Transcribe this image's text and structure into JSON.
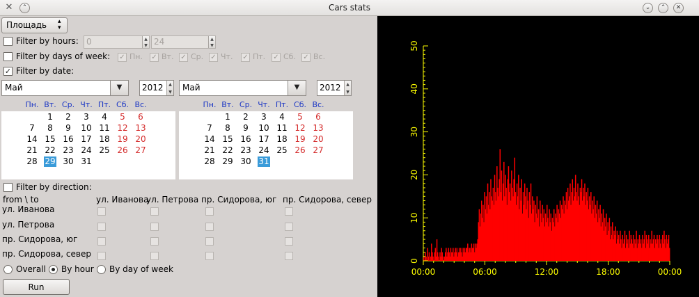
{
  "window": {
    "title": "Cars stats"
  },
  "metric": {
    "selected": "Площадь"
  },
  "hours": {
    "label": "Filter by hours:",
    "from": "0",
    "to": "24",
    "checked": false
  },
  "days_of_week": {
    "label": "Filter by days of week:",
    "checked": false,
    "days": [
      "Пн.",
      "Вт.",
      "Ср.",
      "Чт.",
      "Пт.",
      "Сб.",
      "Вс."
    ]
  },
  "date": {
    "label": "Filter by date:",
    "checked": true
  },
  "calendar_from": {
    "month": "Май",
    "year": "2012",
    "selected_day": 29
  },
  "calendar_to": {
    "month": "Май",
    "year": "2012",
    "selected_day": 31
  },
  "calendar_headers": [
    "Пн.",
    "Вт.",
    "Ср.",
    "Чт.",
    "Пт.",
    "Сб.",
    "Вс."
  ],
  "calendar_weeks": [
    [
      "",
      "1",
      "2",
      "3",
      "4",
      "5",
      "6"
    ],
    [
      "7",
      "8",
      "9",
      "10",
      "11",
      "12",
      "13"
    ],
    [
      "14",
      "15",
      "16",
      "17",
      "18",
      "19",
      "20"
    ],
    [
      "21",
      "22",
      "23",
      "24",
      "25",
      "26",
      "27"
    ],
    [
      "28",
      "29",
      "30",
      "31",
      "",
      "",
      ""
    ]
  ],
  "direction": {
    "label": "Filter by direction:",
    "checked": false,
    "corner": "from \\ to",
    "columns": [
      "ул. Иванова",
      "ул. Петрова",
      "пр. Сидорова, юг",
      "пр. Сидорова, север"
    ],
    "rows": [
      "ул. Иванова",
      "ул. Петрова",
      "пр. Сидорова, юг",
      "пр. Сидорова, север"
    ]
  },
  "mode": {
    "options": [
      "Overall",
      "By hour",
      "By day of week"
    ],
    "selected": "By hour"
  },
  "run_label": "Run",
  "colors": {
    "bars": "#ff0000",
    "axis": "#ffff00",
    "background": "#000000",
    "weekend": "#d42a2a",
    "weekday_header": "#1c37c4",
    "selection": "#3a9bd9"
  },
  "chart_data": {
    "type": "bar",
    "title": "",
    "xlabel": "",
    "ylabel": "",
    "ylim": [
      0,
      50
    ],
    "yticks": [
      "0",
      "10",
      "20",
      "30",
      "40",
      "50"
    ],
    "xlim": [
      "00:00",
      "24:00"
    ],
    "xticks": [
      "00:00",
      "06:00",
      "12:00",
      "18:00",
      "00:00"
    ],
    "bin_minutes": 3,
    "values": [
      1,
      0,
      2,
      1,
      0,
      3,
      1,
      2,
      0,
      1,
      4,
      2,
      1,
      0,
      2,
      3,
      1,
      5,
      2,
      1,
      0,
      2,
      1,
      3,
      2,
      1,
      0,
      1,
      2,
      3,
      1,
      2,
      3,
      2,
      1,
      3,
      2,
      2,
      3,
      1,
      2,
      3,
      2,
      3,
      1,
      2,
      3,
      2,
      3,
      2,
      1,
      3,
      2,
      3,
      2,
      3,
      3,
      4,
      2,
      3,
      3,
      2,
      4,
      3,
      3,
      4,
      2,
      4,
      3,
      4,
      5,
      9,
      12,
      8,
      11,
      14,
      10,
      13,
      9,
      16,
      12,
      15,
      11,
      18,
      13,
      16,
      12,
      19,
      15,
      14,
      17,
      13,
      20,
      16,
      14,
      22,
      17,
      15,
      19,
      26,
      16,
      21,
      14,
      18,
      23,
      15,
      20,
      17,
      13,
      19,
      22,
      16,
      18,
      14,
      21,
      17,
      15,
      19,
      24,
      16,
      13,
      18,
      15,
      20,
      12,
      17,
      14,
      19,
      11,
      16,
      13,
      18,
      15,
      12,
      17,
      14,
      10,
      16,
      13,
      18,
      11,
      15,
      12,
      14,
      9,
      13,
      11,
      15,
      10,
      12,
      8,
      14,
      11,
      9,
      13,
      10,
      12,
      8,
      11,
      9,
      13,
      10,
      8,
      12,
      9,
      11,
      7,
      10,
      9,
      12,
      8,
      11,
      10,
      13,
      9,
      12,
      11,
      14,
      10,
      13,
      12,
      15,
      11,
      14,
      13,
      16,
      12,
      17,
      14,
      15,
      18,
      13,
      16,
      19,
      14,
      17,
      15,
      20,
      16,
      14,
      18,
      15,
      13,
      17,
      16,
      19,
      14,
      17,
      15,
      18,
      13,
      16,
      14,
      17,
      12,
      15,
      13,
      16,
      11,
      14,
      12,
      15,
      10,
      13,
      11,
      14,
      9,
      12,
      10,
      13,
      8,
      11,
      9,
      12,
      7,
      10,
      8,
      11,
      6,
      9,
      7,
      10,
      5,
      8,
      6,
      9,
      5,
      7,
      6,
      8,
      4,
      7,
      5,
      6,
      4,
      7,
      5,
      3,
      6,
      4,
      5,
      7,
      3,
      6,
      4,
      5,
      3,
      7,
      4,
      6,
      5,
      4,
      6,
      3,
      5,
      4,
      7,
      3,
      5,
      4,
      6,
      4,
      5,
      3,
      6,
      4,
      5,
      7,
      3,
      6,
      5,
      4,
      6,
      3,
      5,
      4,
      7,
      4,
      5,
      6,
      3,
      5,
      4,
      6,
      5,
      3,
      6,
      4,
      5,
      3,
      6,
      4,
      7,
      5,
      3,
      6,
      4,
      5,
      6,
      3
    ]
  }
}
